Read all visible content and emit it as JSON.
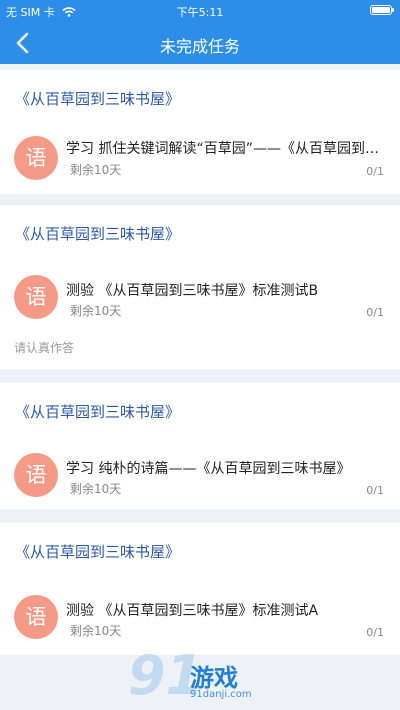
{
  "status_bar": {
    "carrier": "无 SIM 卡",
    "time": "下午5:11",
    "wifi_icon": "wifi-icon",
    "battery_icon": "battery-icon"
  },
  "nav": {
    "title": "未完成任务",
    "back_icon": "chevron-left-icon"
  },
  "tasks": [
    {
      "book": "《从百草园到三味书屋》",
      "avatar": "语",
      "title": "学习  抓住关键词解读“百草园”——《从百草园到三味书屋》",
      "remaining": "剩余10天",
      "count": "0/1",
      "note": ""
    },
    {
      "book": "《从百草园到三味书屋》",
      "avatar": "语",
      "title": "测验  《从百草园到三味书屋》标准测试B",
      "remaining": "剩余10天",
      "count": "0/1",
      "note": "请认真作答"
    },
    {
      "book": "《从百草园到三味书屋》",
      "avatar": "语",
      "title": "学习  纯朴的诗篇——《从百草园到三味书屋》",
      "remaining": "剩余10天",
      "count": "0/1",
      "note": ""
    },
    {
      "book": "《从百草园到三味书屋》",
      "avatar": "语",
      "title": "测验  《从百草园到三味书屋》标准测试A",
      "remaining": "剩余10天",
      "count": "0/1",
      "note": ""
    }
  ],
  "watermark": {
    "number": "91",
    "text": "游戏",
    "site": "91danji.com"
  },
  "colors": {
    "header": "#2d8ee9",
    "book_link": "#2b5aa7",
    "avatar": "#f59a86",
    "background": "#eef1f5"
  }
}
